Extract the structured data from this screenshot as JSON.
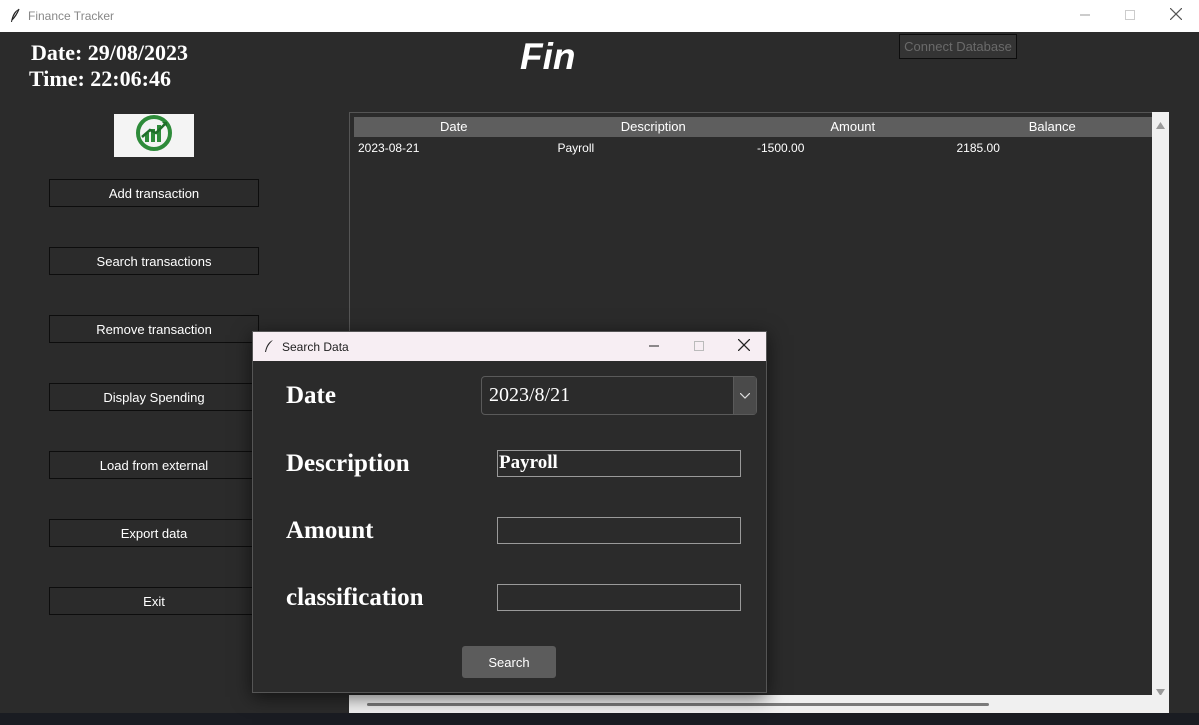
{
  "window": {
    "title": "Finance Tracker"
  },
  "clock": {
    "date": "Date: 29/08/2023",
    "time": "Time: 22:06:46"
  },
  "heading": "Fin",
  "connect_label": "Connect Database",
  "sidebar": {
    "items": [
      {
        "label": "Add transaction"
      },
      {
        "label": "Search transactions"
      },
      {
        "label": "Remove transaction"
      },
      {
        "label": "Display Spending"
      },
      {
        "label": "Load from external"
      },
      {
        "label": "Export data"
      },
      {
        "label": "Exit"
      }
    ]
  },
  "table": {
    "columns": [
      "Date",
      "Description",
      "Amount",
      "Balance"
    ],
    "rows": [
      [
        "2023-08-21",
        "Payroll",
        "-1500.00",
        "2185.00"
      ]
    ]
  },
  "dialog": {
    "title": "Search Data",
    "date_label": "Date",
    "date_value": "2023/8/21",
    "description_label": "Description",
    "description_value": "Payroll",
    "amount_label": "Amount",
    "amount_value": "",
    "classification_label": "classification",
    "classification_value": "",
    "search_label": "Search"
  },
  "colors": {
    "background": "#2b2b2b",
    "header_row": "#5e5e5e",
    "search_button": "#5c5c5c",
    "dialog_titlebar": "#f7eef3"
  },
  "icons": [
    "feather-icon",
    "minimize-icon",
    "maximize-icon",
    "close-icon",
    "chevron-down-icon",
    "logo-chart-icon"
  ]
}
